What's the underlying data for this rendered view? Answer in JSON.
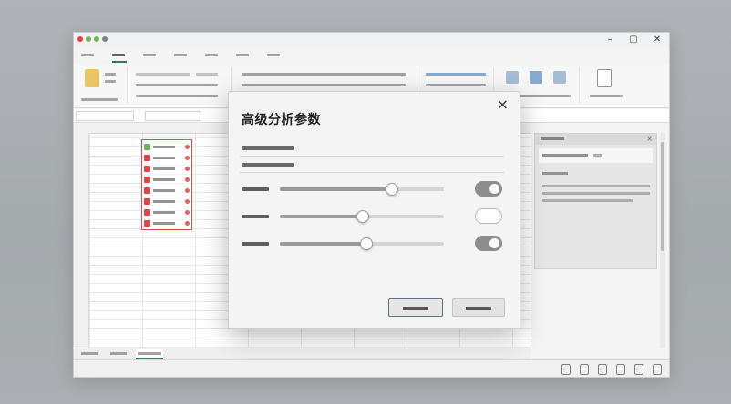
{
  "window": {
    "tabs": [
      "",
      "",
      "",
      "",
      "",
      "",
      ""
    ],
    "active_tab_index": 1
  },
  "dialog": {
    "title": "高级分析参数",
    "close_glyph": "×",
    "section_1_label": "",
    "section_2_label": "",
    "params": [
      {
        "label": "",
        "slider_value": 0.68,
        "toggle_on": true
      },
      {
        "label": "",
        "slider_value": 0.5,
        "toggle_on": false
      },
      {
        "label": "",
        "slider_value": 0.52,
        "toggle_on": true
      }
    ],
    "confirm_label": "",
    "cancel_label": ""
  },
  "side_pane": {
    "title": "",
    "close_glyph": "×"
  },
  "colors": {
    "selection_border": "#d84040",
    "accent_green": "#1f6f43",
    "primary_button_border": "#5f6f86"
  },
  "icons": {
    "window_controls": [
      "minimize-icon",
      "maximize-icon",
      "close-icon"
    ],
    "dialog_close": "close-icon"
  }
}
